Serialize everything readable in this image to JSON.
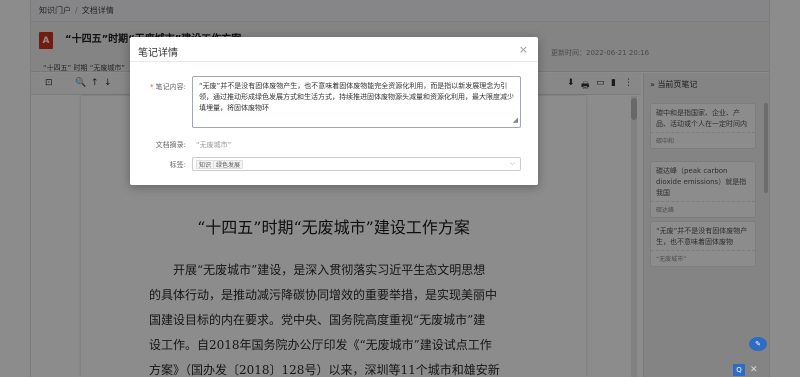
{
  "breadcrumb": {
    "root": "知识门户",
    "separator": "/",
    "current": "文档详情"
  },
  "doc": {
    "pdf_badge": "A",
    "title": "“十四五”时期“无废城市”建设工作方案",
    "update_label": "更新时间：",
    "update_time": "2022-06-21 20:16",
    "tag_line": "“十四五” 时期 “无废城市”"
  },
  "toolbar": {
    "sidebar_toggle": "⊡",
    "search": "🔍",
    "up": "↑",
    "down": "↓",
    "download": "⬇",
    "print": "🖶",
    "folder": "▭",
    "bookmark": "▮",
    "more": "⋮",
    "expand": "»"
  },
  "side": {
    "title": "» 当前页笔记",
    "notes": [
      {
        "text": "碳中和是指国家、企业、产品、活动或个人在一定时间内",
        "tag": "碳中和"
      },
      {
        "text": "碳达峰（peak carbon dioxide emissions）就是指我国",
        "tag": "碳达峰"
      },
      {
        "text": "“无废”并不是没有固体废物产生，也不意味着固体废物",
        "tag": "“无废城市”"
      }
    ]
  },
  "page": {
    "title": "“十四五”时期“无废城市”建设工作方案",
    "lines": [
      "开展“无废城市”建设，是深入贯彻落实习近平生态文明思想",
      "的具体行动，是推动减污降碳协同增效的重要举措，是实现美丽中",
      "国建设目标的内在要求。党中央、国务院高度重视“无废城市”建",
      "设工作。自2018年国务院办公厅印发《“无废城市”建设试点工作",
      "方案》（国办发〔2018〕128号）以来，深圳等11个城市和雄安新"
    ]
  },
  "modal": {
    "title": "笔记详情",
    "close": "×",
    "note_label": "笔记内容:",
    "required_mark": "*",
    "note_content": "“无废”并不是没有固体废物产生，也不意味着固体废物能完全资源化利用，而是指以新发展理念为引领，通过推动形成绿色发展方式和生活方式，持续推进固体废物源头减量和资源化利用，最大限度减少填埋量，将固体废物环",
    "excerpt_label": "文档摘录:",
    "excerpt_value": "“无废城市”",
    "tags_label": "标签:",
    "tags": [
      "知识",
      "绿色发展"
    ],
    "dropdown_icon": "⌵",
    "resize_grip": "◢"
  },
  "widgets": {
    "float_label": "✎",
    "corner_label": "Q",
    "corner_close": "✕"
  }
}
